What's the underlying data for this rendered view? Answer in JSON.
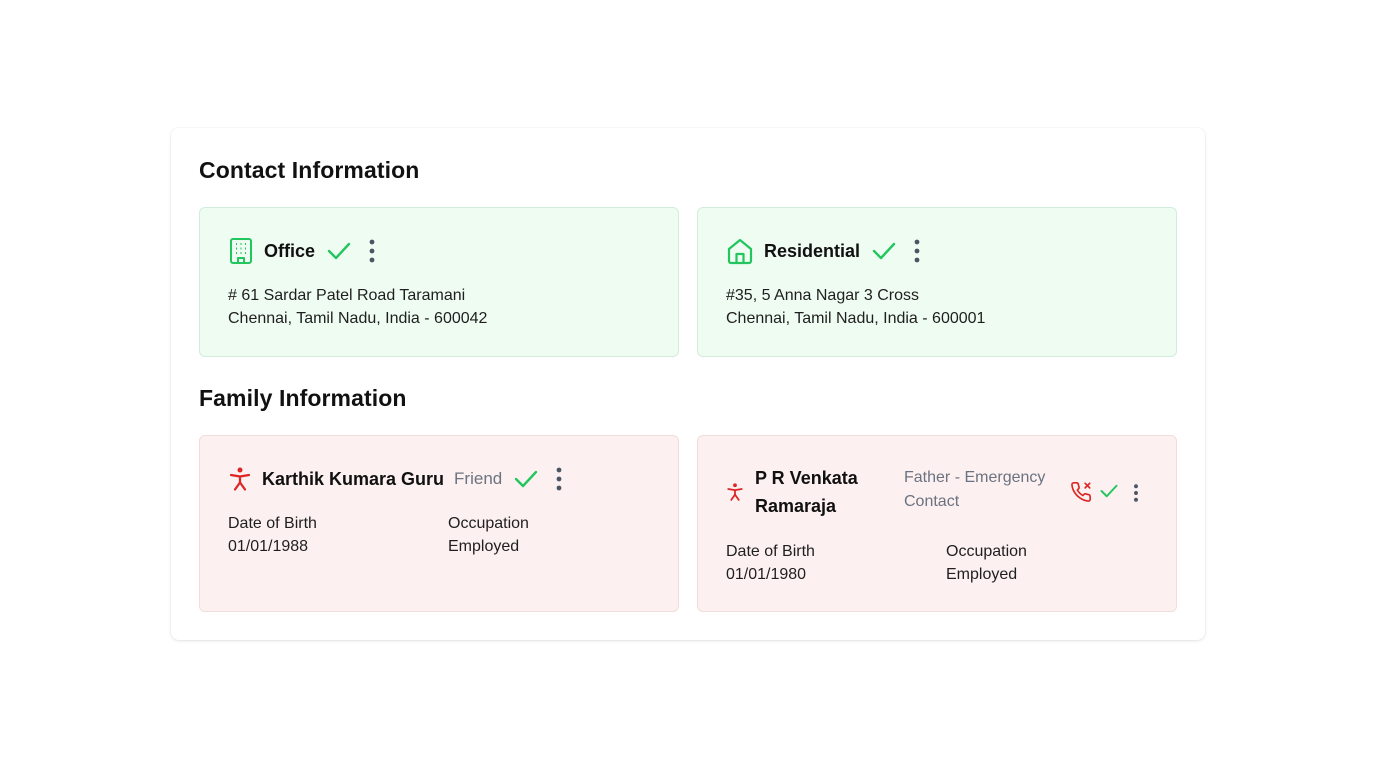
{
  "contact": {
    "title": "Contact Information",
    "cards": [
      {
        "icon": "building-icon",
        "title": "Office",
        "verified": true,
        "address_line1": "# 61 Sardar Patel Road Taramani",
        "address_line2": "Chennai, Tamil Nadu, India - 600042"
      },
      {
        "icon": "home-icon",
        "title": "Residential",
        "verified": true,
        "address_line1": "#35, 5 Anna Nagar 3 Cross",
        "address_line2": "Chennai, Tamil Nadu, India - 600001"
      }
    ]
  },
  "family": {
    "title": "Family Information",
    "members": [
      {
        "icon": "person-icon",
        "name": "Karthik Kumara Guru",
        "relation": "Friend",
        "verified": true,
        "dob_label": "Date of Birth",
        "dob_value": "01/01/1988",
        "occupation_label": "Occupation",
        "occupation_value": "Employed"
      },
      {
        "icon": "person-icon",
        "name_line1": "P R Venkata",
        "name_line2": "Ramaraja",
        "relation_line1": "Father - Emergency",
        "relation_line2": "Contact",
        "emergency_icon": "phone-missed-icon",
        "verified": true,
        "dob_label": "Date of Birth",
        "dob_value": "01/01/1980",
        "occupation_label": "Occupation",
        "occupation_value": "Employed"
      }
    ]
  },
  "colors": {
    "green_accent": "#22c55e",
    "red_accent": "#dc2626",
    "green_card_bg": "#effcf2",
    "red_card_bg": "#fcf1f0",
    "muted_text": "#6b7280",
    "kebab": "#4b5563"
  }
}
